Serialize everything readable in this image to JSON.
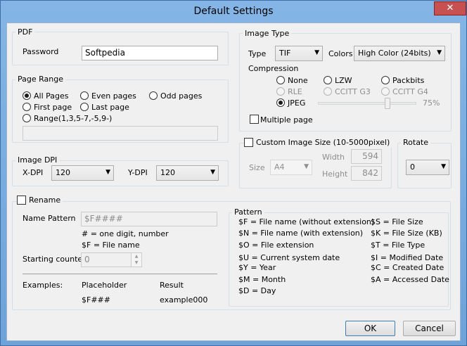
{
  "window": {
    "title": "Default Settings",
    "close_glyph": "✕"
  },
  "pdf": {
    "group_label": "PDF",
    "password_label": "Password",
    "password_value": "Softpedia"
  },
  "page_range": {
    "group_label": "Page Range",
    "all_pages": "All Pages",
    "even_pages": "Even pages",
    "odd_pages": "Odd pages",
    "first_page": "First page",
    "last_page": "Last page",
    "range": "Range(1,3,5-7,-5,9-)",
    "range_value": ""
  },
  "image_dpi": {
    "group_label": "Image DPI",
    "xdpi_label": "X-DPI",
    "xdpi_value": "120",
    "ydpi_label": "Y-DPI",
    "ydpi_value": "120"
  },
  "image_type": {
    "group_label": "Image Type",
    "type_label": "Type",
    "type_value": "TIF",
    "colors_label": "Colors",
    "colors_value": "High Color (24bits)",
    "compression_label": "Compression",
    "none": "None",
    "lzw": "LZW",
    "packbits": "Packbits",
    "rle": "RLE",
    "ccitt_g3": "CCITT G3",
    "ccitt_g4": "CCITT G4",
    "jpeg": "JPEG",
    "quality": "75%",
    "quality_fraction": 0.75,
    "multiple_page": "Multiple page"
  },
  "custom_size": {
    "label": "Custom Image Size (10-5000pixel)",
    "size_label": "Size",
    "size_value": "A4",
    "width_label": "Width",
    "width_value": "594",
    "height_label": "Height",
    "height_value": "842"
  },
  "rotate": {
    "group_label": "Rotate",
    "value": "0"
  },
  "rename": {
    "label": "Rename",
    "name_pattern_label": "Name Pattern",
    "name_pattern_value": "$F####",
    "hint1": "# = one digit, number",
    "hint2": "$F = File name",
    "starting_counter_label": "Starting counter",
    "starting_counter_value": "0",
    "examples_label": "Examples:",
    "placeholder_header": "Placeholder",
    "result_header": "Result",
    "placeholder_value": "$F###",
    "result_value": "example000"
  },
  "pattern": {
    "group_label": "Pattern",
    "left": [
      "$F = File name (without extension)",
      "$N = File name (with extension)",
      "$O = File extension",
      "$U = Current system date",
      "$Y = Year",
      "$M = Month",
      "$D = Day"
    ],
    "right": [
      "$S = File Size",
      "$K = File Size (KB)",
      "$T = File Type",
      "$I = Modified Date",
      "$C = Created Date",
      "$A = Accessed Date"
    ]
  },
  "buttons": {
    "ok": "OK",
    "cancel": "Cancel"
  }
}
